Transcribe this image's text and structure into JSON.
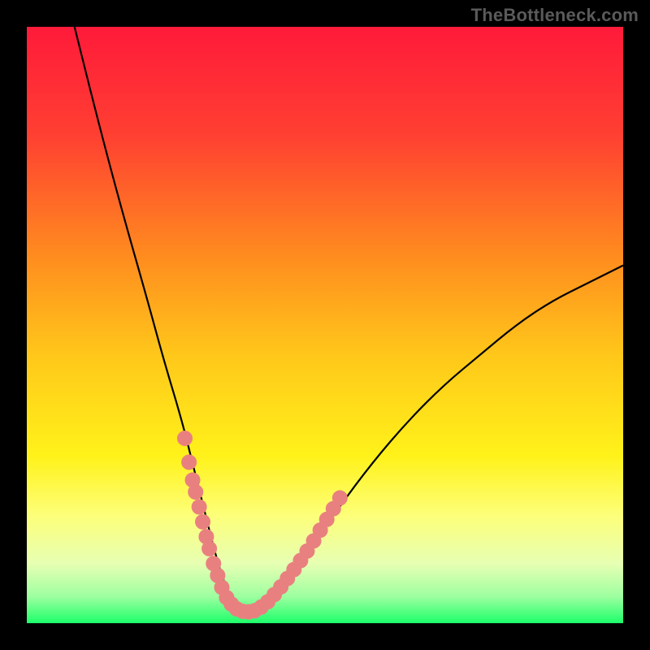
{
  "watermark": "TheBottleneck.com",
  "chart_data": {
    "type": "line",
    "title": "",
    "xlabel": "",
    "ylabel": "",
    "xlim": [
      0,
      100
    ],
    "ylim": [
      0,
      100
    ],
    "grid": false,
    "legend": false,
    "background_gradient_stops": [
      {
        "offset": 0.0,
        "color": "#ff1a3a"
      },
      {
        "offset": 0.18,
        "color": "#ff3f32"
      },
      {
        "offset": 0.38,
        "color": "#ff8a1f"
      },
      {
        "offset": 0.55,
        "color": "#ffc71a"
      },
      {
        "offset": 0.72,
        "color": "#fff21a"
      },
      {
        "offset": 0.82,
        "color": "#fdff7a"
      },
      {
        "offset": 0.9,
        "color": "#e7ffb3"
      },
      {
        "offset": 0.955,
        "color": "#9effa0"
      },
      {
        "offset": 1.0,
        "color": "#1cff6a"
      }
    ],
    "series": [
      {
        "name": "bottleneck-curve",
        "x": [
          8,
          12,
          16,
          20,
          23,
          26,
          28,
          30,
          31.5,
          33,
          34.5,
          36,
          38,
          41,
          46,
          52,
          58,
          64,
          70,
          76,
          82,
          88,
          94,
          100
        ],
        "y": [
          100,
          84,
          69,
          55,
          44,
          34,
          26,
          18,
          12,
          7,
          4,
          2,
          2,
          4,
          10,
          19,
          27,
          34,
          40,
          45,
          50,
          54,
          57,
          60
        ]
      }
    ],
    "highlight_points": [
      {
        "x": 26.5,
        "y": 31
      },
      {
        "x": 27.2,
        "y": 27
      },
      {
        "x": 27.8,
        "y": 24
      },
      {
        "x": 28.3,
        "y": 22
      },
      {
        "x": 28.9,
        "y": 19.5
      },
      {
        "x": 29.5,
        "y": 17
      },
      {
        "x": 30.1,
        "y": 14.5
      },
      {
        "x": 30.6,
        "y": 12.5
      },
      {
        "x": 31.3,
        "y": 10
      },
      {
        "x": 32.0,
        "y": 8
      },
      {
        "x": 32.7,
        "y": 6
      },
      {
        "x": 33.5,
        "y": 4.3
      },
      {
        "x": 34.3,
        "y": 3.2
      },
      {
        "x": 35.2,
        "y": 2.4
      },
      {
        "x": 36.2,
        "y": 2.0
      },
      {
        "x": 37.2,
        "y": 1.9
      },
      {
        "x": 38.2,
        "y": 2.1
      },
      {
        "x": 39.3,
        "y": 2.7
      },
      {
        "x": 40.4,
        "y": 3.6
      },
      {
        "x": 41.5,
        "y": 4.8
      },
      {
        "x": 42.6,
        "y": 6.1
      },
      {
        "x": 43.7,
        "y": 7.5
      },
      {
        "x": 44.8,
        "y": 9.0
      },
      {
        "x": 45.9,
        "y": 10.5
      },
      {
        "x": 47.0,
        "y": 12.1
      },
      {
        "x": 48.1,
        "y": 13.8
      },
      {
        "x": 49.2,
        "y": 15.6
      },
      {
        "x": 50.3,
        "y": 17.4
      },
      {
        "x": 51.4,
        "y": 19.2
      },
      {
        "x": 52.5,
        "y": 21.0
      }
    ],
    "colors": {
      "curve": "#000000",
      "highlight_fill": "#e98080",
      "highlight_stroke": "#e98080"
    }
  }
}
